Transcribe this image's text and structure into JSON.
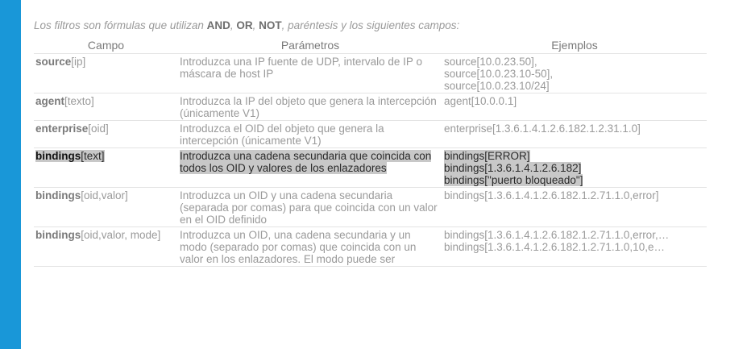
{
  "intro": {
    "prefix": "Los filtros son fórmulas que utilizan ",
    "kw_and": "AND",
    "sep1": ", ",
    "kw_or": "OR",
    "sep2": ", ",
    "kw_not": "NOT",
    "suffix": ", paréntesis y los siguientes campos:"
  },
  "table": {
    "headers": [
      "Campo",
      "Parámetros",
      "Ejemplos"
    ],
    "rows": [
      {
        "field": "source",
        "args": "[ip]",
        "params": "Introduzca una IP fuente de UDP, intervalo de IP o máscara de host IP",
        "examples": [
          "source[10.0.23.50],",
          "source[10.0.23.10-50],",
          "source[10.0.23.10/24]"
        ]
      },
      {
        "field": "agent",
        "args": "[texto]",
        "params": "Introduzca la IP del objeto que genera la intercepción (únicamente V1)",
        "examples": [
          "agent[10.0.0.1]"
        ]
      },
      {
        "field": "enterprise",
        "args": "[oid]",
        "params": "Introduzca el OID del objeto que genera la intercepción (únicamente V1)",
        "examples": [
          "enterprise[1.3.6.1.4.1.2.6.182.1.2.31.1.0]"
        ]
      },
      {
        "field": "bindings",
        "args": "[text]",
        "params": "Introduzca una cadena secundaria que coincida con todos los OID y valores de los enlazadores",
        "examples": [
          "bindings[ERROR]",
          "bindings[1.3.6.1.4.1.2.6.182]",
          "bindings[\"puerto bloqueado\"]"
        ]
      },
      {
        "field": "bindings",
        "args": "[oid,valor]",
        "params": "Introduzca un OID y una cadena secundaria (separada por comas) para que coincida con un valor en el OID definido",
        "examples": [
          "bindings[1.3.6.1.4.1.2.6.182.1.2.71.1.0,error]"
        ]
      },
      {
        "field": "bindings",
        "args": "[oid,valor, mode]",
        "params": "Introduzca un OID, una cadena secundaria y un modo (separado por comas) que coincida con un valor en los enlazadores. El modo puede ser",
        "examples": [
          "bindings[1.3.6.1.4.1.2.6.182.1.2.71.1.0,error,…",
          "bindings[1.3.6.1.4.1.2.6.182.1.2.71.1.0,10,e…"
        ]
      }
    ]
  },
  "colors": {
    "accent_bar": "#1997d8",
    "highlight": "#c8c8c8"
  }
}
